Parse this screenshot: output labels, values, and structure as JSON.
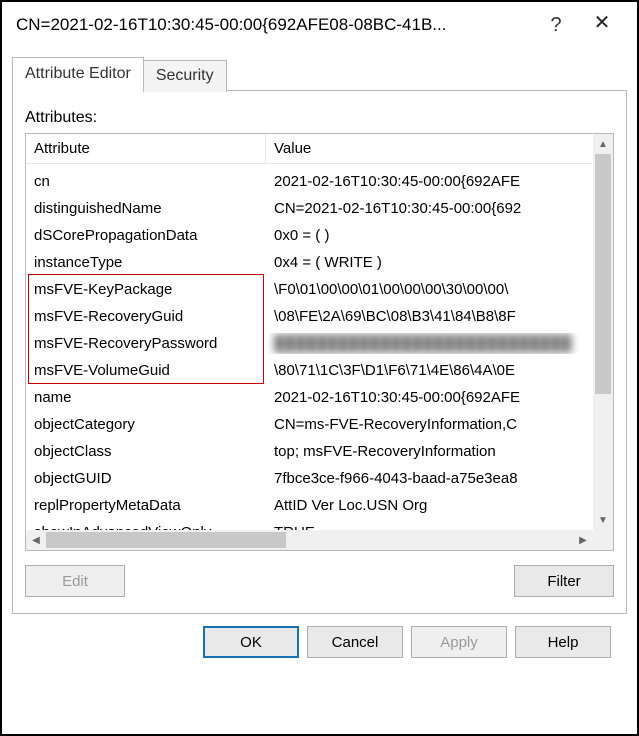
{
  "window": {
    "title": "CN=2021-02-16T10:30:45-00:00{692AFE08-08BC-41B...",
    "help": "?",
    "close": "✕"
  },
  "tabs": {
    "active": "Attribute Editor",
    "inactive": "Security"
  },
  "panel": {
    "attributes_label": "Attributes:",
    "columns": {
      "attribute": "Attribute",
      "value": "Value"
    },
    "rows": [
      {
        "attr": "cn",
        "val": "2021-02-16T10:30:45-00:00{692AFE"
      },
      {
        "attr": "distinguishedName",
        "val": "CN=2021-02-16T10:30:45-00:00{692"
      },
      {
        "attr": "dSCorePropagationData",
        "val": "0x0 = (  )"
      },
      {
        "attr": "instanceType",
        "val": "0x4 = ( WRITE )"
      },
      {
        "attr": "msFVE-KeyPackage",
        "val": "\\F0\\01\\00\\00\\01\\00\\00\\00\\30\\00\\00\\"
      },
      {
        "attr": "msFVE-RecoveryGuid",
        "val": "\\08\\FE\\2A\\69\\BC\\08\\B3\\41\\84\\B8\\8F"
      },
      {
        "attr": "msFVE-RecoveryPassword",
        "val": "████████████████████████████",
        "redacted": true
      },
      {
        "attr": "msFVE-VolumeGuid",
        "val": "\\80\\71\\1C\\3F\\D1\\F6\\71\\4E\\86\\4A\\0E"
      },
      {
        "attr": "name",
        "val": "2021-02-16T10:30:45-00:00{692AFE"
      },
      {
        "attr": "objectCategory",
        "val": "CN=ms-FVE-RecoveryInformation,C"
      },
      {
        "attr": "objectClass",
        "val": "top; msFVE-RecoveryInformation"
      },
      {
        "attr": "objectGUID",
        "val": "7fbce3ce-f966-4043-baad-a75e3ea8"
      },
      {
        "attr": "replPropertyMetaData",
        "val": " AttID  Ver    Loc.USN               Org"
      },
      {
        "attr": "showInAdvancedViewOnly",
        "val": "TRUE"
      }
    ],
    "highlighted_rows": [
      4,
      5,
      6,
      7
    ],
    "edit_button": "Edit",
    "filter_button": "Filter"
  },
  "buttons": {
    "ok": "OK",
    "cancel": "Cancel",
    "apply": "Apply",
    "help": "Help"
  }
}
